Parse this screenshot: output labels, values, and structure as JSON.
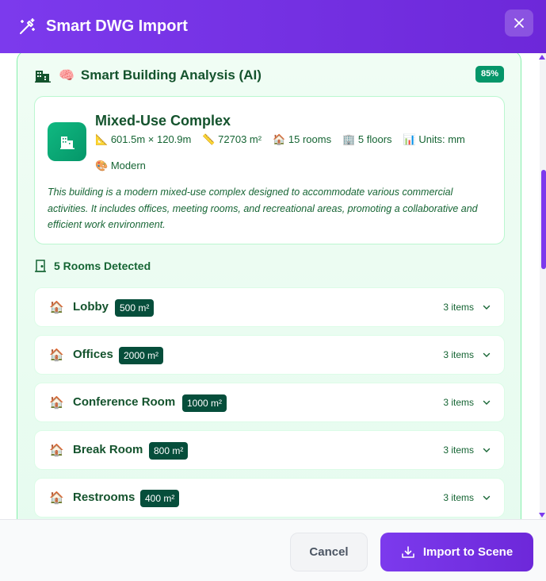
{
  "dialog": {
    "title": "Smart DWG Import",
    "title_icon": "magic-wand-icon",
    "close_icon": "close-icon"
  },
  "analysis": {
    "title": "Smart Building Analysis (AI)",
    "title_emoji": "🧠",
    "confidence": "85%",
    "building": {
      "name": "Mixed-Use Complex",
      "dimensions": "601.5m × 120.9m",
      "dimensions_emoji": "📐",
      "area": "72703 m²",
      "area_emoji": "📏",
      "rooms": "15 rooms",
      "rooms_emoji": "🏠",
      "floors": "5 floors",
      "floors_emoji": "🏢",
      "units": "Units: mm",
      "units_emoji": "📊",
      "style": "Modern",
      "style_emoji": "🎨",
      "description": "This building is a modern mixed-use complex designed to accommodate various commercial activities. It includes offices, meeting rooms, and recreational areas, promoting a collaborative and efficient work environment."
    }
  },
  "rooms_section": {
    "title": "5 Rooms Detected",
    "rooms": [
      {
        "emoji": "🏠",
        "name": "Lobby",
        "area": "500 m²",
        "items": "3 items"
      },
      {
        "emoji": "🏠",
        "name": "Offices",
        "area": "2000 m²",
        "items": "3 items"
      },
      {
        "emoji": "🏠",
        "name": "Conference Room",
        "area": "1000 m²",
        "items": "3 items"
      },
      {
        "emoji": "🏠",
        "name": "Break Room",
        "area": "800 m²",
        "items": "3 items"
      },
      {
        "emoji": "🏠",
        "name": "Restrooms",
        "area": "400 m²",
        "items": "3 items"
      }
    ]
  },
  "footer": {
    "cancel_label": "Cancel",
    "import_label": "Import to Scene"
  },
  "colors": {
    "brand_purple": "#7c3aed",
    "accent_green": "#059669",
    "badge_dark_green": "#064e3b",
    "text_green": "#14532d"
  }
}
